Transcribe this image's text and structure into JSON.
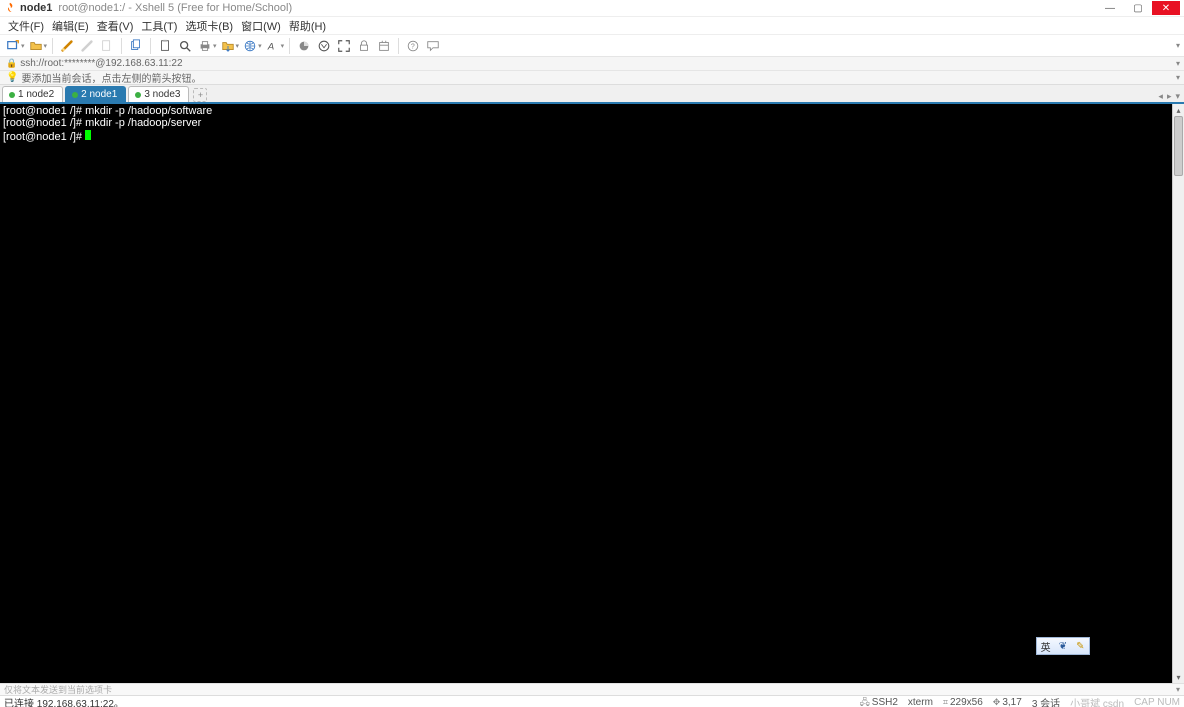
{
  "titlebar": {
    "name": "node1",
    "desc": "root@node1:/ - Xshell 5 (Free for Home/School)"
  },
  "menu": {
    "file": "文件(F)",
    "edit": "编辑(E)",
    "view": "查看(V)",
    "tools": "工具(T)",
    "tabs": "选项卡(B)",
    "window": "窗口(W)",
    "help": "帮助(H)"
  },
  "addressbar": {
    "text": "ssh://root:********@192.168.63.11:22"
  },
  "tipbar": {
    "text": "要添加当前会话，点击左侧的箭头按钮。"
  },
  "tabs": [
    {
      "num": "1",
      "label": "node2",
      "active": false
    },
    {
      "num": "2",
      "label": "node1",
      "active": true
    },
    {
      "num": "3",
      "label": "node3",
      "active": false
    }
  ],
  "terminal": {
    "lines": [
      {
        "prompt": "[root@node1 /]# ",
        "cmd": "mkdir -p /hadoop/software"
      },
      {
        "prompt": "[root@node1 /]# ",
        "cmd": "mkdir -p /hadoop/server"
      },
      {
        "prompt": "[root@node1 /]# ",
        "cmd": "",
        "cursor": true
      }
    ]
  },
  "ime": {
    "lang": "英",
    "mid": "❦",
    "right": "✎"
  },
  "hintbar": {
    "text": "仅将文本发送到当前选项卡"
  },
  "statusbar": {
    "left": "已连接 192.168.63.11:22。",
    "ssh": "SSH2",
    "term": "xterm",
    "size": "229x56",
    "sess": "3,17",
    "sessions": "3 会话",
    "watermark": "CAP   NUM",
    "watermark2": "小哥斌 csdn"
  }
}
